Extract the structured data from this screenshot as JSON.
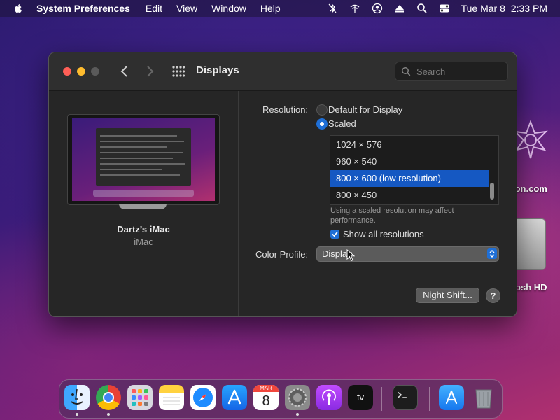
{
  "menubar": {
    "app_name": "System Preferences",
    "items": [
      "Edit",
      "View",
      "Window",
      "Help"
    ],
    "date": "Tue Mar 8",
    "time": "2:33 PM"
  },
  "desktop": {
    "icon1_label": "ion.com",
    "icon2_label": "osh HD"
  },
  "window": {
    "title": "Displays",
    "search_placeholder": "Search"
  },
  "device": {
    "name": "Dartz’s iMac",
    "model": "iMac"
  },
  "resolution": {
    "label": "Resolution:",
    "option_default": "Default for Display",
    "option_scaled": "Scaled",
    "selected": "Scaled",
    "list": [
      "1024 × 576",
      "960 × 540",
      "800 × 600 (low resolution)",
      "800 × 450"
    ],
    "selected_index": 2,
    "note": "Using a scaled resolution may affect performance.",
    "show_all_label": "Show all resolutions",
    "show_all_checked": true
  },
  "color_profile": {
    "label": "Color Profile:",
    "value": "Display"
  },
  "buttons": {
    "night_shift": "Night Shift...",
    "help": "?"
  },
  "dock": {
    "apps": [
      "Finder",
      "Chrome",
      "Launchpad",
      "Notes",
      "Safari",
      "App Store",
      "Calendar",
      "System Preferences",
      "Podcasts",
      "Apple TV",
      "Terminal",
      "Downloads",
      "Trash"
    ],
    "calendar_month": "MAR",
    "calendar_day": "8",
    "tv_label": "tv"
  },
  "colors": {
    "accent": "#1f6fd6",
    "selection": "#1558c2",
    "window_bg": "#262626"
  }
}
